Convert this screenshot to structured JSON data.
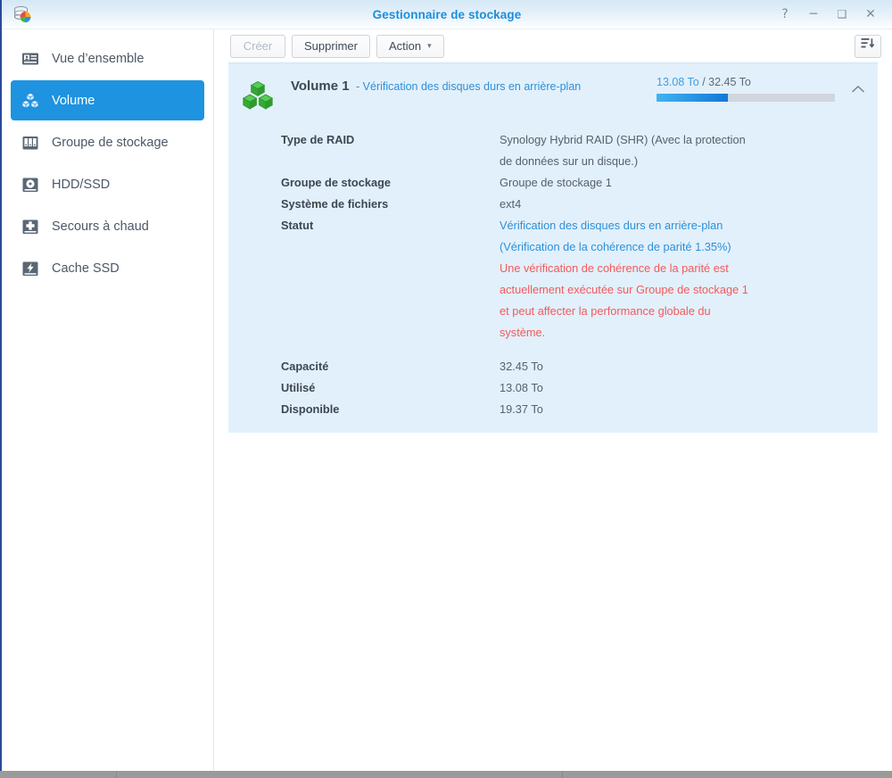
{
  "window": {
    "title": "Gestionnaire de stockage",
    "app_icon": "storage-manager-icon",
    "controls": {
      "help": "?",
      "minimize": "─",
      "maximize": "❑",
      "close": "✕"
    }
  },
  "sidebar": {
    "items": [
      {
        "label": "Vue d’ensemble",
        "icon": "overview-icon",
        "active": false
      },
      {
        "label": "Volume",
        "icon": "volume-cubes-icon",
        "active": true
      },
      {
        "label": "Groupe de stockage",
        "icon": "storage-pool-icon",
        "active": false
      },
      {
        "label": "HDD/SSD",
        "icon": "disk-icon",
        "active": false
      },
      {
        "label": "Secours à chaud",
        "icon": "hot-spare-icon",
        "active": false
      },
      {
        "label": "Cache SSD",
        "icon": "ssd-cache-icon",
        "active": false
      }
    ]
  },
  "toolbar": {
    "create_label": "Créer",
    "create_disabled": true,
    "delete_label": "Supprimer",
    "action_label": "Action",
    "action_caret": "▾",
    "sort_icon": "sort-descending-icon"
  },
  "volume": {
    "icon": "green-cubes-icon",
    "title": "Volume 1",
    "subtitle": "- Vérification des disques durs en arrière-plan",
    "collapse_icon": "chevron-up-icon",
    "gauge": {
      "used": "13.08 To",
      "separator": " / ",
      "total": "32.45 To",
      "fill_percent": 40
    },
    "details": [
      {
        "label": "Type de RAID",
        "lines": [
          {
            "text": "Synology Hybrid RAID (SHR) (Avec la protection",
            "color": "default"
          },
          {
            "text": "de données sur un disque.)",
            "color": "default"
          }
        ]
      },
      {
        "label": "Groupe de stockage",
        "lines": [
          {
            "text": "Groupe de stockage 1",
            "color": "default"
          }
        ]
      },
      {
        "label": "Système de fichiers",
        "lines": [
          {
            "text": "ext4",
            "color": "default"
          }
        ]
      },
      {
        "label": "Statut",
        "lines": [
          {
            "text": "Vérification des disques durs en arrière-plan",
            "color": "blue"
          },
          {
            "text": "(Vérification de la cohérence de parité 1.35%)",
            "color": "blue"
          },
          {
            "text": "Une vérification de cohérence de la parité est",
            "color": "red"
          },
          {
            "text": "actuellement exécutée sur Groupe de stockage 1",
            "color": "red"
          },
          {
            "text": "et peut affecter la performance globale du",
            "color": "red"
          },
          {
            "text": "système.",
            "color": "red"
          }
        ]
      },
      {
        "label": "Capacité",
        "lines": [
          {
            "text": "32.45 To",
            "color": "default"
          }
        ],
        "gap_before": true
      },
      {
        "label": "Utilisé",
        "lines": [
          {
            "text": "13.08 To",
            "color": "default"
          }
        ]
      },
      {
        "label": "Disponible",
        "lines": [
          {
            "text": "19.37 To",
            "color": "default"
          }
        ]
      }
    ]
  },
  "colors": {
    "accent_blue": "#1e93e0",
    "title_blue": "#1a8fdc",
    "link_blue": "#2d90d8",
    "warning_red": "#f4595b",
    "panel_bg": "#e2f0fb",
    "cube_green": "#3fb83f"
  }
}
